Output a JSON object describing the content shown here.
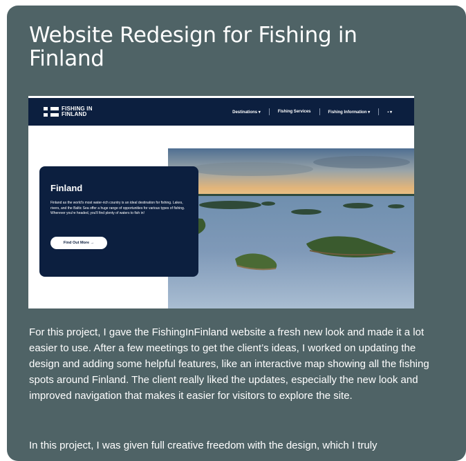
{
  "page": {
    "title": "Website Redesign for Fishing in Finland",
    "paragraphs": [
      "For this project, I gave the FishingInFinland website a fresh new look and made it a lot easier to use. After a few meetings to get the client’s ideas, I worked on updating the design and adding some helpful features, like an interactive map showing all the fishing spots around Finland. The client really liked the updates, especially the new look and improved navigation that makes it easier for visitors to explore the site.",
      "In this project, I was given full creative freedom with the design, which I truly"
    ]
  },
  "preview": {
    "logo_line1": "FISHING IN",
    "logo_line2": "FINLAND",
    "nav": [
      "Destinations ▾",
      "Fishing Services",
      "Fishing Information ▾",
      "▪ ▾"
    ],
    "hero_title": "Finland",
    "hero_text": "Finland as the world's most water-rich country is an ideal destination for fishing. Lakes, rivers, and the Baltic Sea offer a huge range of opportunities for various types of fishing. Wherever you're headed, you'll find plenty of waters to fish in!",
    "hero_button": "Find Out More →"
  },
  "colors": {
    "card_background": "#4f6366",
    "navy": "#0c1f3f",
    "text": "#ffffff"
  }
}
